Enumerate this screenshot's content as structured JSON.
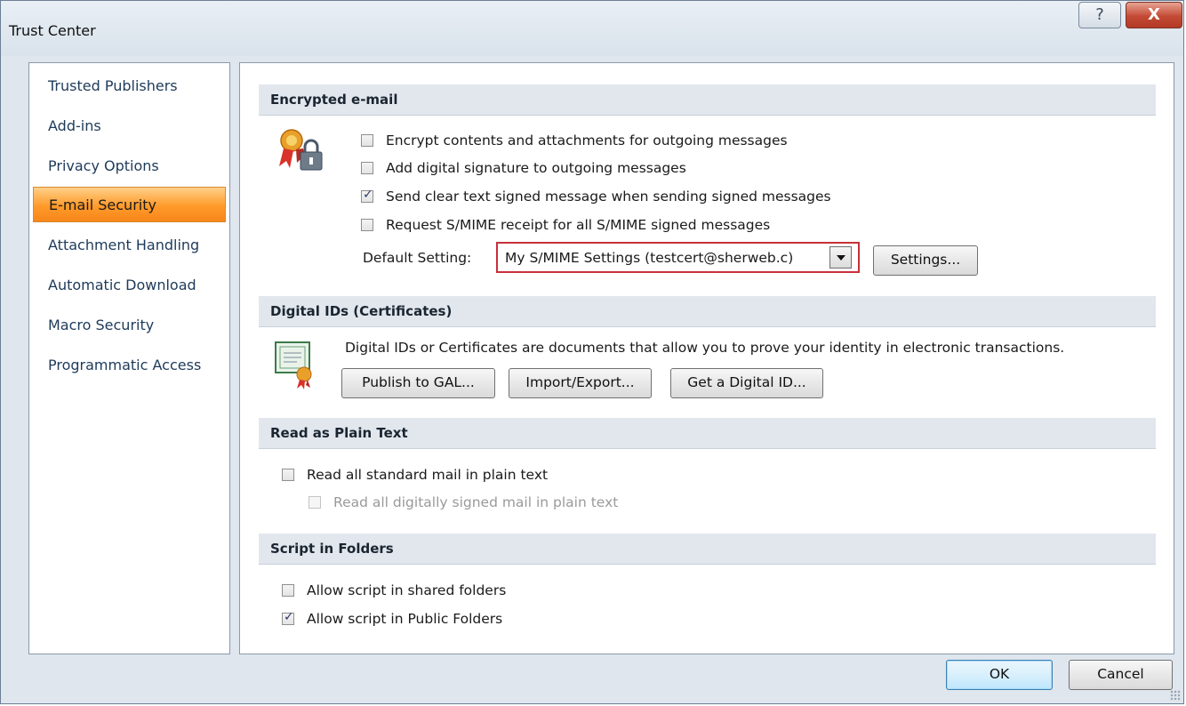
{
  "window": {
    "title": "Trust Center",
    "help_glyph": "?",
    "close_glyph": "X"
  },
  "sidebar": {
    "items": [
      {
        "label": "Trusted Publishers",
        "active": false
      },
      {
        "label": "Add-ins",
        "active": false
      },
      {
        "label": "Privacy Options",
        "active": false
      },
      {
        "label": "E-mail Security",
        "active": true
      },
      {
        "label": "Attachment Handling",
        "active": false
      },
      {
        "label": "Automatic Download",
        "active": false
      },
      {
        "label": "Macro Security",
        "active": false
      },
      {
        "label": "Programmatic Access",
        "active": false
      }
    ]
  },
  "encrypted": {
    "header": "Encrypted e-mail",
    "options": [
      {
        "label": "Encrypt contents and attachments for outgoing messages",
        "checked": false
      },
      {
        "label": "Add digital signature to outgoing messages",
        "checked": false
      },
      {
        "label": "Send clear text signed message when sending signed messages",
        "checked": true
      },
      {
        "label": "Request S/MIME receipt for all S/MIME signed messages",
        "checked": false
      }
    ],
    "default_label": "Default Setting:",
    "default_value": "My S/MIME Settings (testcert@sherweb.c)",
    "settings_button": "Settings..."
  },
  "digital_ids": {
    "header": "Digital IDs (Certificates)",
    "description": "Digital IDs or Certificates are documents that allow you to prove your identity in electronic transactions.",
    "publish_button": "Publish to GAL...",
    "import_button": "Import/Export...",
    "get_button": "Get a Digital ID..."
  },
  "plain_text": {
    "header": "Read as Plain Text",
    "read_all": {
      "label": "Read all standard mail in plain text",
      "checked": false
    },
    "read_signed": {
      "label": "Read all digitally signed mail in plain text",
      "checked": false,
      "disabled": true
    }
  },
  "script": {
    "header": "Script in Folders",
    "shared": {
      "label": "Allow script in shared folders",
      "checked": false
    },
    "public": {
      "label": "Allow script in Public Folders",
      "checked": true
    }
  },
  "footer": {
    "ok": "OK",
    "cancel": "Cancel"
  },
  "icons": {
    "security": "ribbon-lock-icon",
    "certificate": "certificate-icon"
  },
  "colors": {
    "active_nav": "#ff9a2a",
    "highlight_border": "#c8303a",
    "close_button": "#c34a35"
  }
}
